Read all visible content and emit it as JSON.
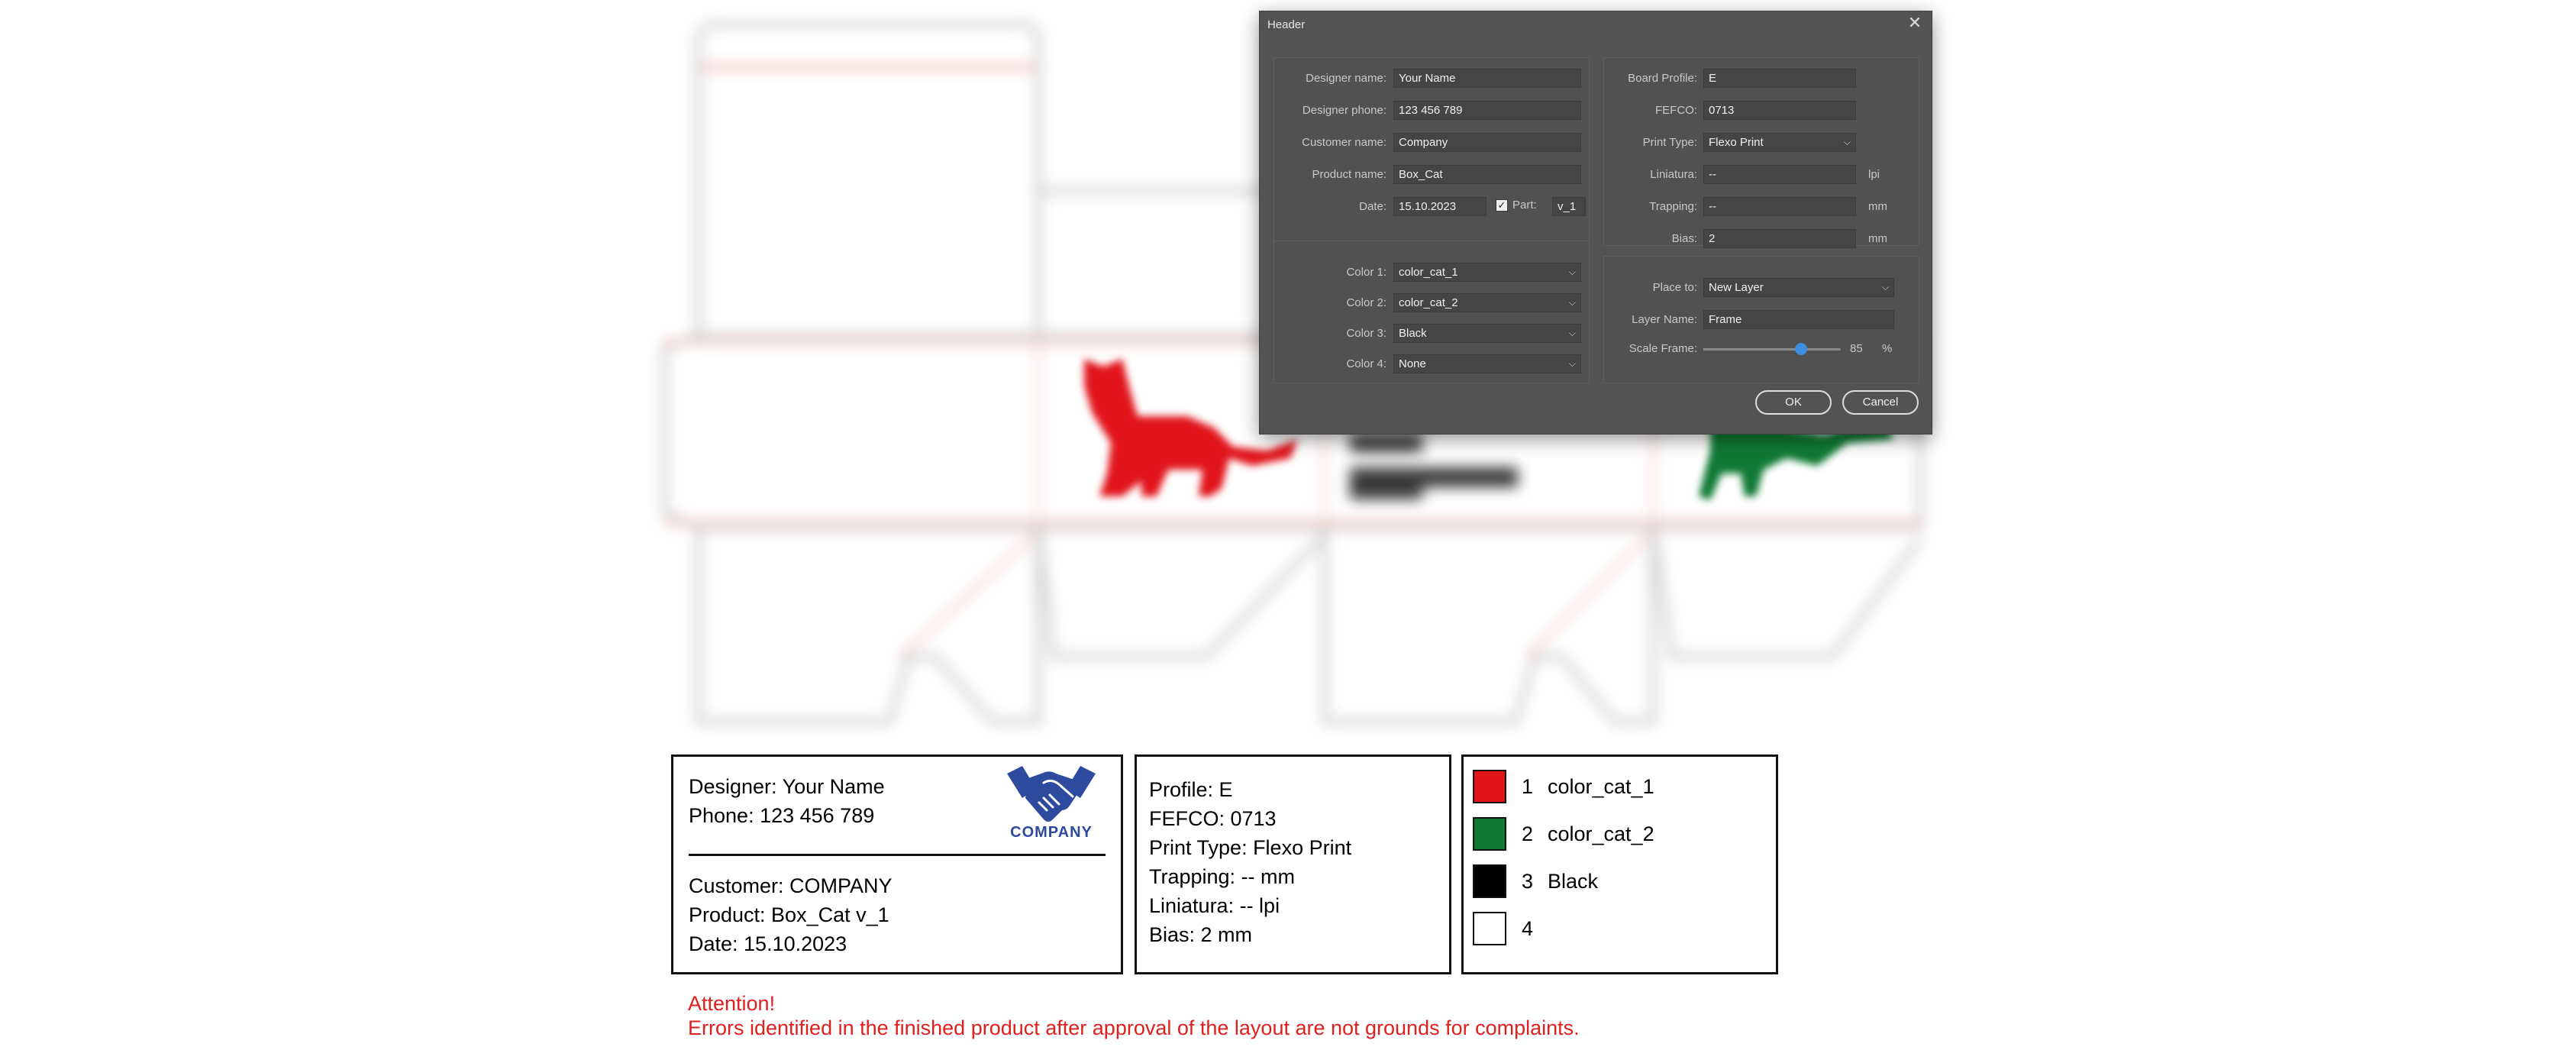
{
  "dialog": {
    "title": "Header",
    "close_icon": "close-icon",
    "designer": {
      "designer_name_label": "Designer name:",
      "designer_name_value": "Your Name",
      "designer_phone_label": "Designer phone:",
      "designer_phone_value": "123 456 789",
      "customer_name_label": "Customer name:",
      "customer_name_value": "Company",
      "product_name_label": "Product name:",
      "product_name_value": "Box_Cat",
      "date_label": "Date:",
      "date_value": "15.10.2023",
      "part_label": "Part:",
      "part_checked": true,
      "part_value": "v_1"
    },
    "board": {
      "board_profile_label": "Board Profile:",
      "board_profile_value": "E",
      "fefco_label": "FEFCO:",
      "fefco_value": "0713",
      "print_type_label": "Print Type:",
      "print_type_value": "Flexo Print",
      "liniatura_label": "Liniatura:",
      "liniatura_value": "--",
      "liniatura_unit": "lpi",
      "trapping_label": "Trapping:",
      "trapping_value": "--",
      "trapping_unit": "mm",
      "bias_label": "Bias:",
      "bias_value": "2",
      "bias_unit": "mm"
    },
    "colors": {
      "color1_label": "Color 1:",
      "color1_value": "color_cat_1",
      "color2_label": "Color 2:",
      "color2_value": "color_cat_2",
      "color3_label": "Color 3:",
      "color3_value": "Black",
      "color4_label": "Color 4:",
      "color4_value": "None"
    },
    "placement": {
      "place_to_label": "Place to:",
      "place_to_value": "New Layer",
      "layer_name_label": "Layer Name:",
      "layer_name_value": "Frame",
      "scale_frame_label": "Scale Frame:",
      "scale_frame_value": "85",
      "scale_frame_unit": "%",
      "scale_frame_level": 0.71
    },
    "ok_label": "OK",
    "cancel_label": "Cancel"
  },
  "info_blocks": {
    "designer_line": "Designer: Your Name",
    "phone_line": "Phone: 123 456 789",
    "logo_text": "COMPANY",
    "logo_icon": "handshake-icon",
    "customer_line": "Customer: COMPANY",
    "product_line": "Product: Box_Cat v_1",
    "date_line": "Date: 15.10.2023",
    "profile_line": "Profile: E",
    "fefco_line": "FEFCO: 0713",
    "print_type_line": "Print Type: Flexo Print",
    "trapping_line": "Trapping: -- mm",
    "liniatura_line": "Liniatura: -- lpi",
    "bias_line": "Bias: 2 mm",
    "color_list": [
      {
        "num": "1",
        "name": "color_cat_1",
        "swatch": "#e1141b"
      },
      {
        "num": "2",
        "name": "color_cat_2",
        "swatch": "#0f7a33"
      },
      {
        "num": "3",
        "name": "Black",
        "swatch": "#000000"
      },
      {
        "num": "4",
        "name": "",
        "swatch": "#ffffff"
      }
    ]
  },
  "attention": {
    "title": "Attention!",
    "message": "Errors identified in the finished product after approval of the layout are not grounds for complaints."
  },
  "colors": {
    "cat_red": "#e1141b",
    "cat_green": "#0f7a33",
    "accent_blue": "#3f8fe0",
    "dialog_bg": "#535353",
    "attention_red": "#e1201d",
    "logo_blue": "#2e4a9f"
  }
}
